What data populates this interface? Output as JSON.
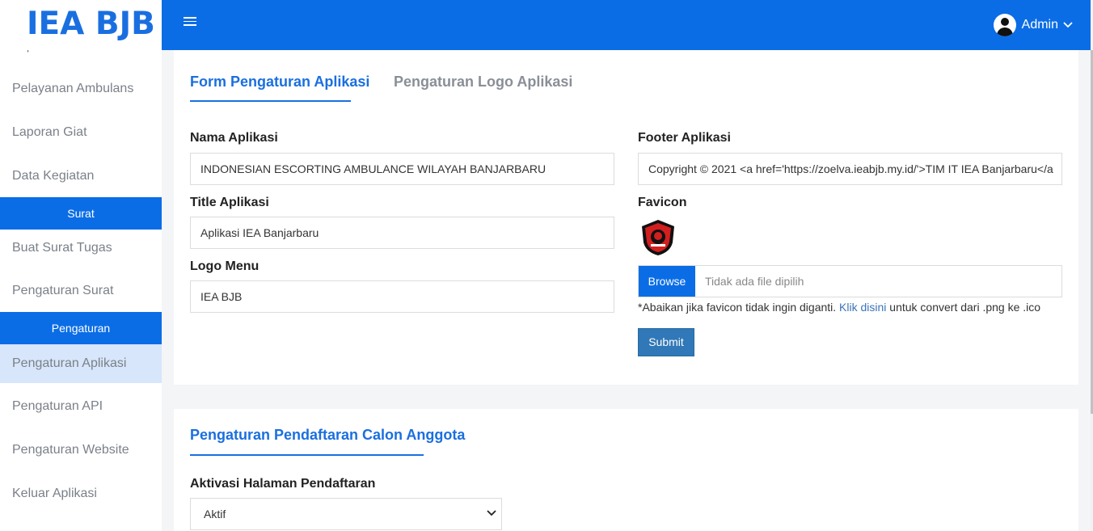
{
  "brand": {
    "title": "IEA BJB"
  },
  "sidebar": {
    "partial_item": "Laporan Kebutuhan",
    "items_top": [
      "Pelayanan Ambulans",
      "Laporan Giat",
      "Data Kegiatan"
    ],
    "header_surat": "Surat",
    "items_surat": [
      "Buat Surat Tugas",
      "Pengaturan Surat"
    ],
    "header_pengaturan": "Pengaturan",
    "items_pengaturan": [
      "Pengaturan Aplikasi",
      "Pengaturan API",
      "Pengaturan Website",
      "Keluar Aplikasi"
    ]
  },
  "topbar": {
    "user": "Admin"
  },
  "settings": {
    "tabs": [
      "Form Pengaturan Aplikasi",
      "Pengaturan Logo Aplikasi"
    ],
    "nama_label": "Nama Aplikasi",
    "nama_value": "INDONESIAN ESCORTING AMBULANCE WILAYAH BANJARBARU",
    "title_label": "Title Aplikasi",
    "title_value": "Aplikasi IEA Banjarbaru",
    "logo_label": "Logo Menu",
    "logo_value": "IEA BJB",
    "footer_label": "Footer Aplikasi",
    "footer_value": "Copyright © 2021 <a href='https://zoelva.ieabjb.my.id/'>TIM IT IEA Banjarbaru</a",
    "favicon_label": "Favicon",
    "browse_label": "Browse",
    "file_placeholder": "Tidak ada file dipilih",
    "note_prefix": "*Abaikan jika favicon tidak ingin diganti.",
    "note_link": "Klik disini",
    "note_suffix": "untuk convert dari .png ke .ico",
    "submit_label": "Submit"
  },
  "registration": {
    "title": "Pengaturan Pendaftaran Calon Anggota",
    "activation_label": "Aktivasi Halaman Pendaftaran",
    "activation_value": "Aktif"
  },
  "colors": {
    "primary": "#0b6de6",
    "accent_text": "#1a6fe0",
    "submit": "#3078b7",
    "active_menu_bg": "#d7e6fa"
  }
}
